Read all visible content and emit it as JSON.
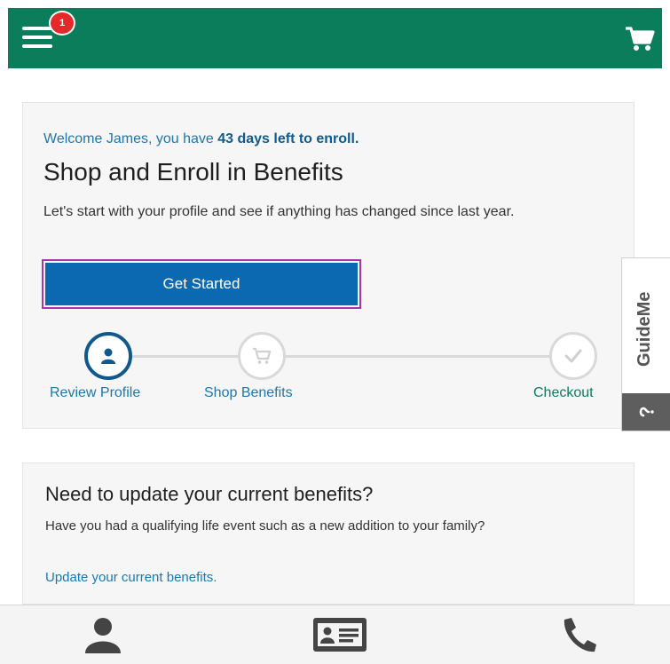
{
  "header": {
    "notification_count": "1",
    "bg_color": "#0b7d5b"
  },
  "enroll": {
    "welcome_prefix": "Welcome James, you have ",
    "welcome_highlight": "43 days left to enroll.",
    "title": "Shop and Enroll in Benefits",
    "description": "Let's start with your profile and see if anything has changed since last year.",
    "button_label": "Get Started"
  },
  "steps": [
    {
      "label": "Review Profile",
      "icon": "person-icon",
      "active": true
    },
    {
      "label": "Shop Benefits",
      "icon": "cart-icon",
      "active": false
    },
    {
      "label": "Checkout",
      "icon": "check-icon",
      "active": false
    }
  ],
  "update": {
    "title": "Need to update your current benefits?",
    "description": "Have you had a qualifying life event such as a new addition to your family?",
    "link": "Update your current benefits."
  },
  "guideme": {
    "label": "GuideMe"
  },
  "bottom_nav": [
    {
      "icon": "person-icon"
    },
    {
      "icon": "id-card-icon"
    },
    {
      "icon": "phone-icon"
    }
  ],
  "colors": {
    "brand_green": "#0b7d5b",
    "primary_blue": "#0b69b1",
    "link_blue": "#1b77b3",
    "focus_outline": "#a936a9"
  }
}
